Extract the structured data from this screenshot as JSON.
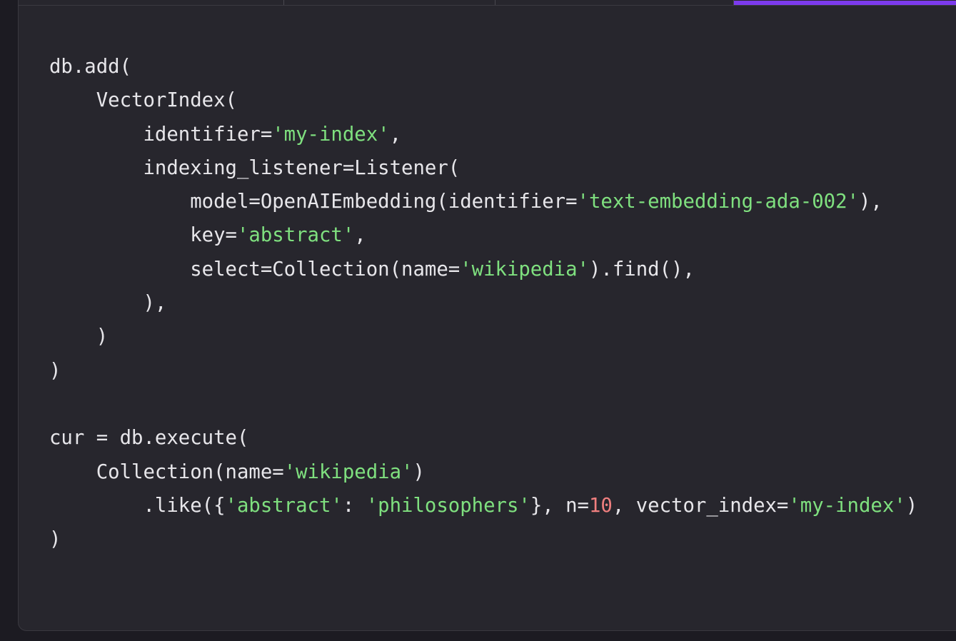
{
  "theme": {
    "accent": "#7c3aed",
    "text": "#e7e6ea",
    "string": "#7fe07f",
    "number": "#f07f7f",
    "background": "#27262d"
  },
  "code_lines": [
    [
      {
        "t": "db.add("
      }
    ],
    [
      {
        "t": "    VectorIndex("
      }
    ],
    [
      {
        "t": "        identifier="
      },
      {
        "t": "'my-index'",
        "k": "str"
      },
      {
        "t": ","
      }
    ],
    [
      {
        "t": "        indexing_listener=Listener("
      }
    ],
    [
      {
        "t": "            model=OpenAIEmbedding(identifier="
      },
      {
        "t": "'text-embedding-ada-002'",
        "k": "str"
      },
      {
        "t": "),"
      }
    ],
    [
      {
        "t": "            key="
      },
      {
        "t": "'abstract'",
        "k": "str"
      },
      {
        "t": ","
      }
    ],
    [
      {
        "t": "            select=Collection(name="
      },
      {
        "t": "'wikipedia'",
        "k": "str"
      },
      {
        "t": ").find(),"
      }
    ],
    [
      {
        "t": "        ),"
      }
    ],
    [
      {
        "t": "    )"
      }
    ],
    [
      {
        "t": ")"
      }
    ],
    [
      {
        "t": ""
      }
    ],
    [
      {
        "t": "cur = db.execute("
      }
    ],
    [
      {
        "t": "    Collection(name="
      },
      {
        "t": "'wikipedia'",
        "k": "str"
      },
      {
        "t": ")"
      }
    ],
    [
      {
        "t": "        .like({"
      },
      {
        "t": "'abstract'",
        "k": "str"
      },
      {
        "t": ": "
      },
      {
        "t": "'philosophers'",
        "k": "str"
      },
      {
        "t": "}, n="
      },
      {
        "t": "10",
        "k": "num"
      },
      {
        "t": ", vector_index="
      },
      {
        "t": "'my-index'",
        "k": "str"
      },
      {
        "t": ")"
      }
    ],
    [
      {
        "t": ")"
      }
    ]
  ]
}
